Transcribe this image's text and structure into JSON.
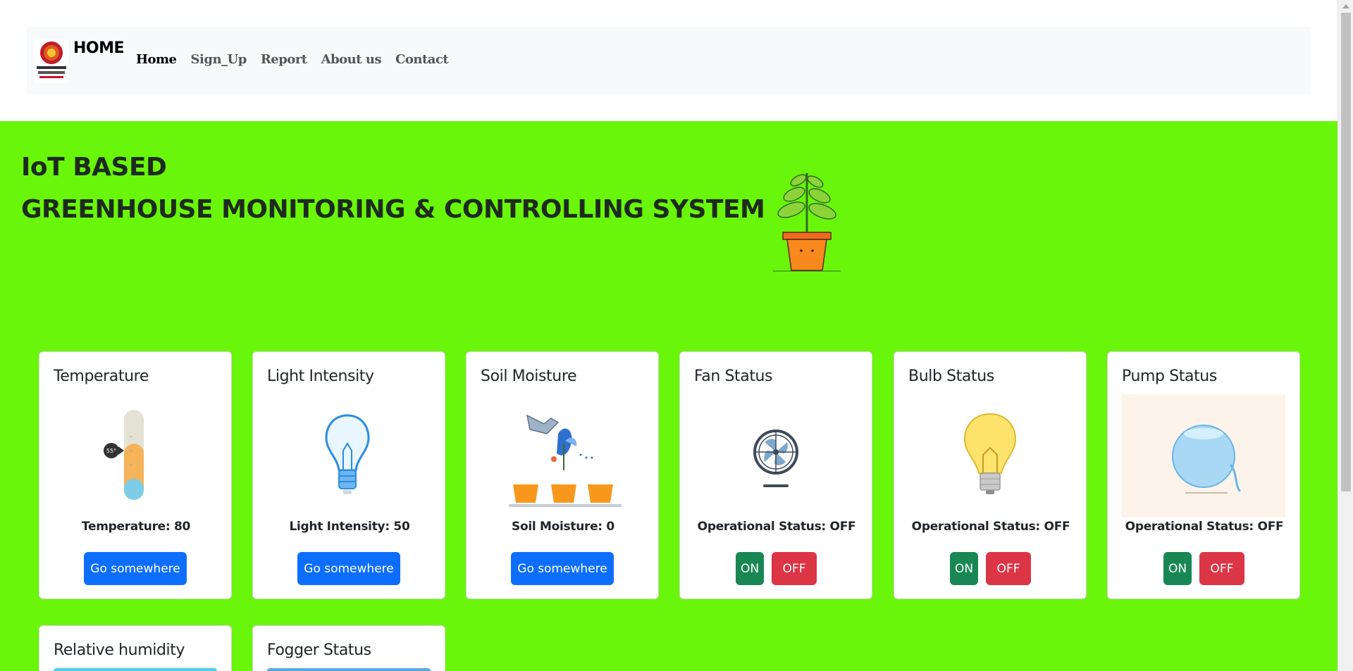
{
  "navbar": {
    "brand": "HOME",
    "links": [
      "Home",
      "Sign_Up",
      "Report",
      "About us",
      "Contact"
    ]
  },
  "hero": {
    "title_line1": "IoT BASED",
    "title_line2": "GREENHOUSE MONITORING & CONTROLLING SYSTEM"
  },
  "cards": [
    {
      "title": "Temperature",
      "text": "Temperature: 80",
      "button": "Go somewhere",
      "icon": "thermometer-icon",
      "thermo_badge": "55°"
    },
    {
      "title": "Light Intensity",
      "text": "Light Intensity: 50",
      "button": "Go somewhere",
      "icon": "lightbulb-outline-icon"
    },
    {
      "title": "Soil Moisture",
      "text": "Soil Moisture: 0",
      "button": "Go somewhere",
      "icon": "watering-plants-icon"
    },
    {
      "title": "Fan Status",
      "text": "Operational Status: OFF",
      "on": "ON",
      "off": "OFF",
      "icon": "fan-icon"
    },
    {
      "title": "Bulb Status",
      "text": "Operational Status: OFF",
      "on": "ON",
      "off": "OFF",
      "icon": "bulb-icon"
    },
    {
      "title": "Pump Status",
      "text": "Operational Status: OFF",
      "on": "ON",
      "off": "OFF",
      "icon": "pump-icon"
    },
    {
      "title": "Relative humidity",
      "icon": "humidity-icon"
    },
    {
      "title": "Fogger Status",
      "icon": "fogger-icon"
    }
  ],
  "colors": {
    "hero_bg": "#69f60a",
    "primary": "#0d6efd",
    "success": "#198754",
    "danger": "#dc3545"
  }
}
